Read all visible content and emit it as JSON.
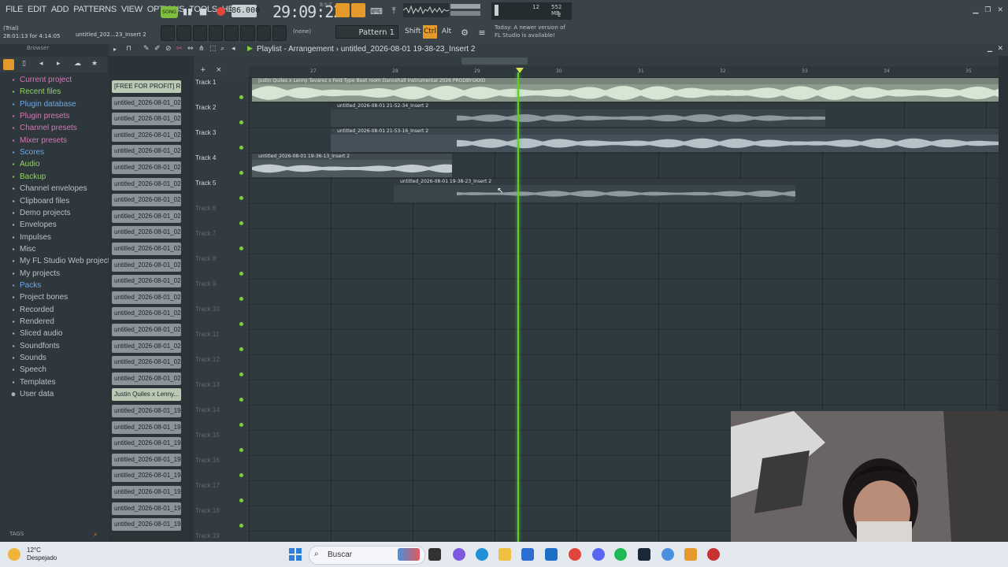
{
  "menu": [
    "FILE",
    "EDIT",
    "ADD",
    "PATTERNS",
    "VIEW",
    "OPTIONS",
    "TOOLS",
    "HELP"
  ],
  "transport": {
    "mode": "SONG",
    "tempo": "86.000",
    "time": "29:09:22",
    "time_small": "B:S:T"
  },
  "trial": {
    "line1": "(Trial)",
    "line2": "28:01:13 for 4:14:05"
  },
  "hint": "untitled_202...23_Insert 2",
  "pattern": {
    "none": "(none)",
    "label": "Pattern 1"
  },
  "keys": [
    "Shift",
    "Ctrl",
    "Alt"
  ],
  "cpu": {
    "value": "12",
    "mem": "552 MB",
    "poly": "2"
  },
  "news": {
    "line1": "Today: A newer version of",
    "line2": "FL Studio is available!"
  },
  "browser": {
    "header": "Browser",
    "items": [
      {
        "label": "Current project",
        "color": "#d07ab4",
        "icon": "folder"
      },
      {
        "label": "Recent files",
        "color": "#8fd45a",
        "icon": "folder"
      },
      {
        "label": "Plugin database",
        "color": "#6fa8e0",
        "icon": "folder"
      },
      {
        "label": "Plugin presets",
        "color": "#d07ab4",
        "icon": "folder"
      },
      {
        "label": "Channel presets",
        "color": "#d07ab4",
        "icon": "folder"
      },
      {
        "label": "Mixer presets",
        "color": "#d07ab4",
        "icon": "folder"
      },
      {
        "label": "Scores",
        "color": "#6fa8e0",
        "icon": "folder"
      },
      {
        "label": "Audio",
        "color": "#8fd45a",
        "icon": "folder"
      },
      {
        "label": "Backup",
        "color": "#8fd45a",
        "icon": "folder"
      },
      {
        "label": "Channel envelopes",
        "color": "#b8c2c6",
        "icon": "folder"
      },
      {
        "label": "Clipboard files",
        "color": "#b8c2c6",
        "icon": "folder"
      },
      {
        "label": "Demo projects",
        "color": "#b8c2c6",
        "icon": "folder"
      },
      {
        "label": "Envelopes",
        "color": "#b8c2c6",
        "icon": "folder"
      },
      {
        "label": "Impulses",
        "color": "#b8c2c6",
        "icon": "folder"
      },
      {
        "label": "Misc",
        "color": "#b8c2c6",
        "icon": "folder"
      },
      {
        "label": "My FL Studio Web projects",
        "color": "#b8c2c6",
        "icon": "folder"
      },
      {
        "label": "My projects",
        "color": "#b8c2c6",
        "icon": "folder"
      },
      {
        "label": "Packs",
        "color": "#6fa8e0",
        "icon": "folder"
      },
      {
        "label": "Project bones",
        "color": "#b8c2c6",
        "icon": "folder"
      },
      {
        "label": "Recorded",
        "color": "#b8c2c6",
        "icon": "folder"
      },
      {
        "label": "Rendered",
        "color": "#b8c2c6",
        "icon": "folder"
      },
      {
        "label": "Sliced audio",
        "color": "#b8c2c6",
        "icon": "folder"
      },
      {
        "label": "Soundfonts",
        "color": "#b8c2c6",
        "icon": "folder"
      },
      {
        "label": "Sounds",
        "color": "#b8c2c6",
        "icon": "folder"
      },
      {
        "label": "Speech",
        "color": "#b8c2c6",
        "icon": "folder"
      },
      {
        "label": "Templates",
        "color": "#b8c2c6",
        "icon": "folder"
      },
      {
        "label": "User data",
        "color": "#b8c2c6",
        "icon": "user"
      }
    ],
    "tags": "TAGS"
  },
  "channels": [
    "[FREE FOR PROFIT] R...",
    "untitled_2026-08-01_02-...",
    "untitled_2026-08-01_02-...",
    "untitled_2026-08-01_02-...",
    "untitled_2026-08-01_02-...",
    "untitled_2026-08-01_02-...",
    "untitled_2026-08-01_02-...",
    "untitled_2026-08-01_02-...",
    "untitled_2026-08-01_02-...",
    "untitled_2026-08-01_02-...",
    "untitled_2026-08-01_02-...",
    "untitled_2026-08-01_02-...",
    "untitled_2026-08-01_02-...",
    "untitled_2026-08-01_02-...",
    "untitled_2026-08-01_02-...",
    "untitled_2026-08-01_02-...",
    "untitled_2026-08-01_02-...",
    "untitled_2026-08-01_02-...",
    "untitled_2026-08-01_02-...",
    "Justin Quiles x Lenny...",
    "untitled_2026-08-01_19-...",
    "untitled_2026-08-01_19-...",
    "untitled_2026-08-01_19-...",
    "untitled_2026-08-01_19-...",
    "untitled_2026-08-01_19-...",
    "untitled_2026-08-01_19-...",
    "untitled_2026-08-01_19-...",
    "untitled_2026-08-01_19-..."
  ],
  "playlist": {
    "title": "Playlist - Arrangement",
    "breadcrumb": "untitled_2026-08-01 19-38-23_Insert 2",
    "ruler": [
      "27",
      "28",
      "29",
      "30",
      "31",
      "32",
      "33",
      "34",
      "35"
    ],
    "tracks": [
      "Track 1",
      "Track 2",
      "Track 3",
      "Track 4",
      "Track 5",
      "Track 6",
      "Track 7",
      "Track 8",
      "Track 9",
      "Track 10",
      "Track 11",
      "Track 12",
      "Track 13",
      "Track 14",
      "Track 15",
      "Track 16",
      "Track 17",
      "Track 18",
      "Track 19"
    ],
    "clips": [
      {
        "track": 1,
        "label": "Justin Quiles x Lenny Tavarez x Feid Type Beat room Dancehall Instrumental 2026  PRODBYGKKO"
      },
      {
        "track": 2,
        "label": "untitled_2026-08-01 21-52-34_Insert 2"
      },
      {
        "track": 3,
        "label": "untitled_2026-08-01 21-53-16_Insert 2"
      },
      {
        "track": 4,
        "label": "untitled_2026-08-01 19-36-13_Insert 2"
      },
      {
        "track": 5,
        "label": "untitled_2026-08-01 19-38-23_Insert 2"
      }
    ]
  },
  "taskbar": {
    "temp": "12°C",
    "weather": "Despejado",
    "search": "Buscar"
  }
}
